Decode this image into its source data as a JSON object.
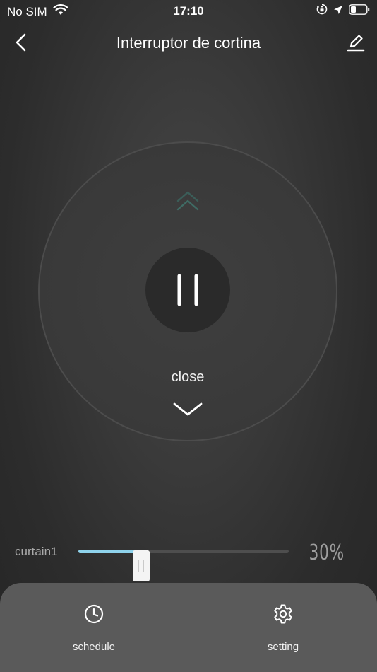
{
  "status_bar": {
    "carrier": "No SIM",
    "time": "17:10"
  },
  "nav": {
    "title": "Interruptor de cortina"
  },
  "control": {
    "state_label": "close"
  },
  "slider": {
    "label": "curtain1",
    "value": 30,
    "value_text": "30%"
  },
  "bottom_actions": [
    {
      "label": "schedule",
      "icon": "clock-icon"
    },
    {
      "label": "setting",
      "icon": "gear-icon"
    }
  ],
  "colors": {
    "accent": "#8fd3ec",
    "background": "#2f2f2f",
    "panel": "#5a5a5a",
    "open_arrow": "#3f6b64"
  }
}
